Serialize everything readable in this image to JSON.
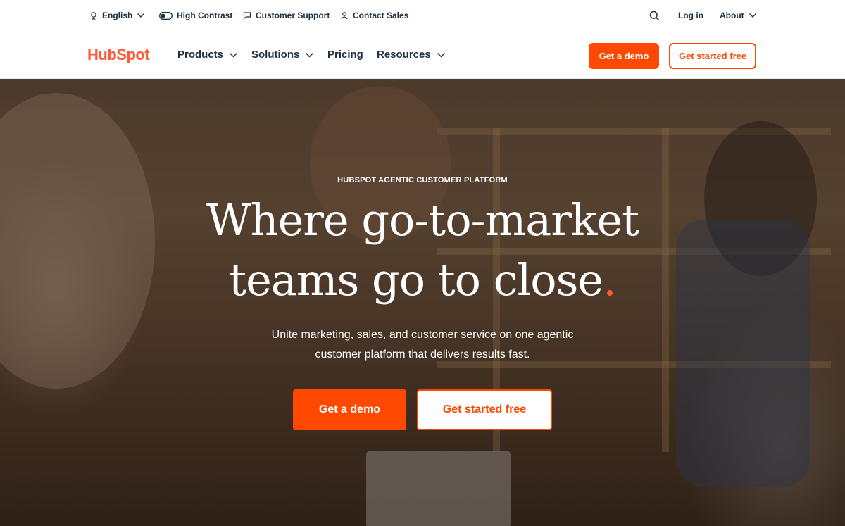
{
  "utility": {
    "language": "English",
    "high_contrast": "High Contrast",
    "customer_support": "Customer Support",
    "contact_sales": "Contact Sales",
    "login": "Log in",
    "about": "About"
  },
  "nav": {
    "logo": "HubSpot",
    "products": "Products",
    "solutions": "Solutions",
    "pricing": "Pricing",
    "resources": "Resources",
    "demo_button": "Get a demo",
    "free_button": "Get started free"
  },
  "hero": {
    "eyebrow": "HUBSPOT AGENTIC CUSTOMER PLATFORM",
    "headline_line1": "Where go-to-market",
    "headline_line2": "teams go to",
    "headline_word": "close",
    "headline_dot": ".",
    "subtext_line1": "Unite marketing, sales, and customer service on one agentic",
    "subtext_line2": "customer platform that delivers results fast.",
    "demo_button": "Get a demo",
    "free_button": "Get started free"
  },
  "colors": {
    "brand": "#ff5c35",
    "cta": "#ff4800",
    "text": "#213343"
  }
}
